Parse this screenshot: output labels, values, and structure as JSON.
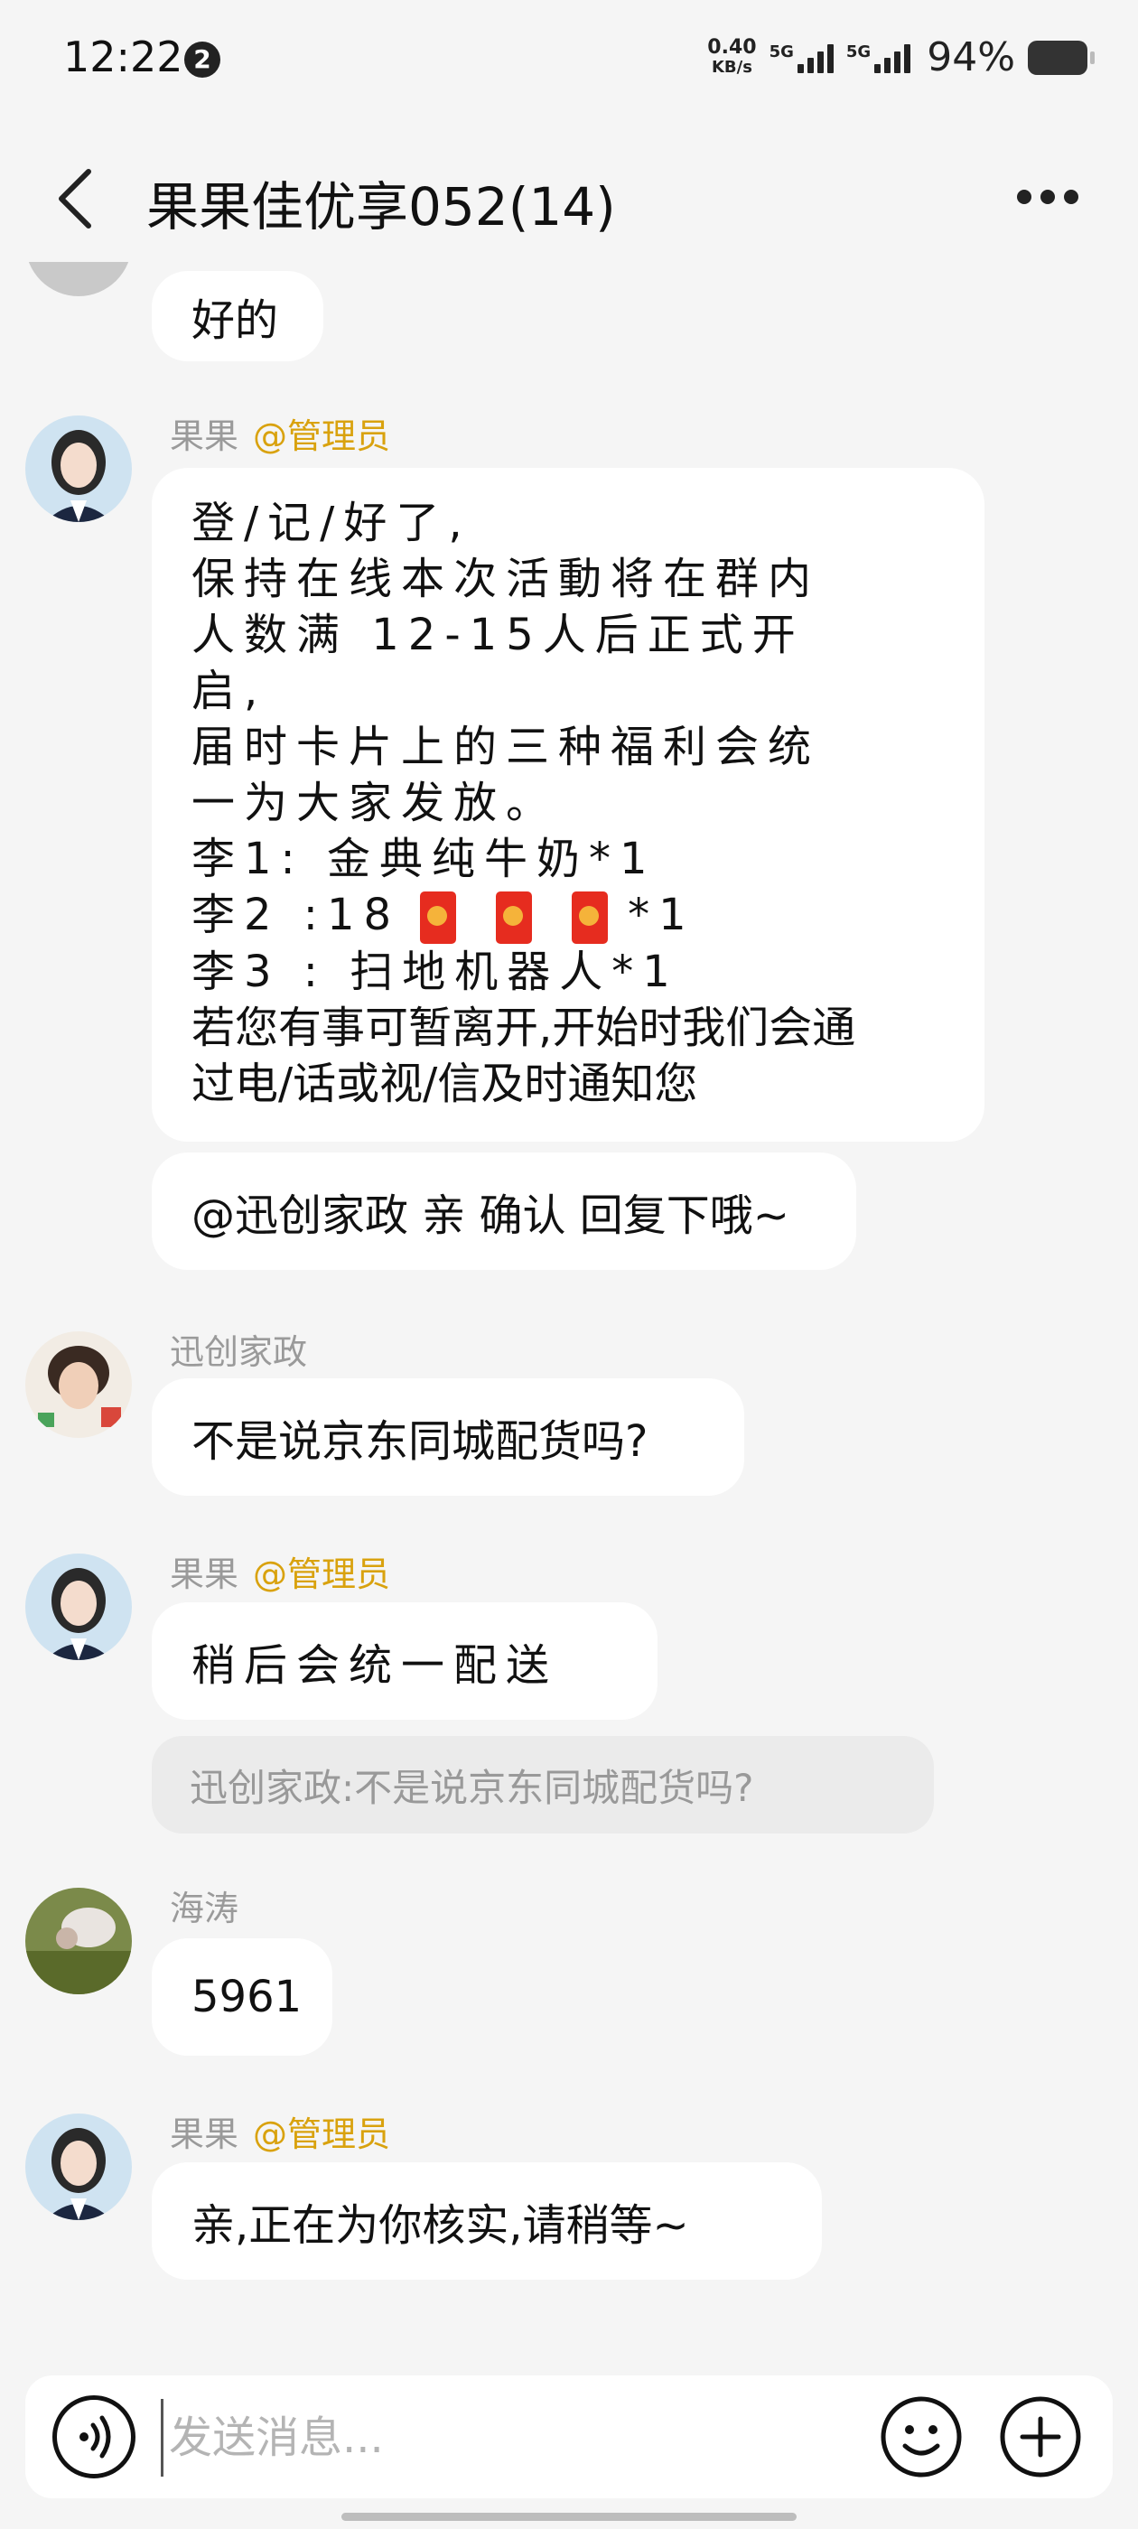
{
  "status_bar": {
    "time": "12:22",
    "notification_count": "2",
    "net_speed_value": "0.40",
    "net_speed_unit": "KB/s",
    "sim1_label": "5G",
    "sim2_label": "5G",
    "battery_text": "94%"
  },
  "header": {
    "title": "果果佳优享052(14)",
    "back_icon": "chevron-left-icon",
    "more_icon": "more-horizontal-icon"
  },
  "messages": [
    {
      "text": "好的"
    },
    {
      "sender": "果果",
      "role_tag": "@管理员",
      "lines": [
        "登/记/好了,",
        "保持在线本次活動将在群内",
        "人数满 12-15人后正式开",
        "启,",
        "届时卡片上的三种福利会统",
        "一为大家发放。",
        "李1: 金典纯牛奶*1",
        "李2 :18",
        "*1",
        "李3 : 扫地机器人*1",
        "若您有事可暂离开,开始时我们会通",
        "过电/话或视/信及时通知您"
      ]
    },
    {
      "text": "@迅创家政 亲 确认 回复下哦~"
    },
    {
      "sender": "迅创家政",
      "text": "不是说京东同城配货吗?"
    },
    {
      "sender": "果果",
      "role_tag": "@管理员",
      "text": "稍后会统一配送",
      "quote": "迅创家政:不是说京东同城配货吗?"
    },
    {
      "sender": "海涛",
      "text": "5961"
    },
    {
      "sender": "果果",
      "role_tag": "@管理员",
      "text": "亲,正在为你核实,请稍等~"
    }
  ],
  "input_bar": {
    "placeholder": "发送消息...",
    "voice_icon": "voice-icon",
    "emoji_icon": "emoji-icon",
    "plus_icon": "plus-icon"
  },
  "colors": {
    "background": "#f5f5f5",
    "bubble": "#ffffff",
    "admin_tag": "#d9a20e",
    "sender_name": "#9a9a9a",
    "quote_bg": "#ebebeb",
    "hongbao": "#e62c1f"
  }
}
